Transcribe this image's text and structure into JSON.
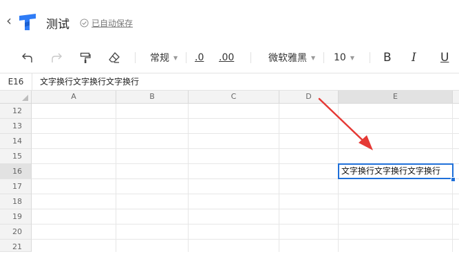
{
  "header": {
    "back_icon": "chevron-left-icon",
    "logo_icon": "app-logo-icon",
    "title": "测试",
    "save_status": "已自动保存",
    "save_icon": "check-circle-icon"
  },
  "toolbar": {
    "undo_icon": "undo-icon",
    "redo_icon": "redo-icon",
    "format_painter_icon": "format-painter-icon",
    "clear_format_icon": "eraser-icon",
    "number_format": "常规",
    "decrease_decimal": ".0",
    "increase_decimal": ".00",
    "font_family": "微软雅黑",
    "font_size": "10",
    "bold": "B",
    "italic": "I",
    "underline": "U"
  },
  "formula_bar": {
    "cell_ref": "E16",
    "content": "文字换行文字换行文字换行"
  },
  "sheet": {
    "columns": [
      "A",
      "B",
      "C",
      "D",
      "E"
    ],
    "rows": [
      "12",
      "13",
      "14",
      "15",
      "16",
      "17",
      "18",
      "19",
      "20",
      "21"
    ],
    "active_column": "E",
    "active_row": "16",
    "selected_cell_text": "文字换行文字换行文字换行",
    "selection_color": "#1e6fd9",
    "annotation_arrow_color": "#e53935"
  }
}
